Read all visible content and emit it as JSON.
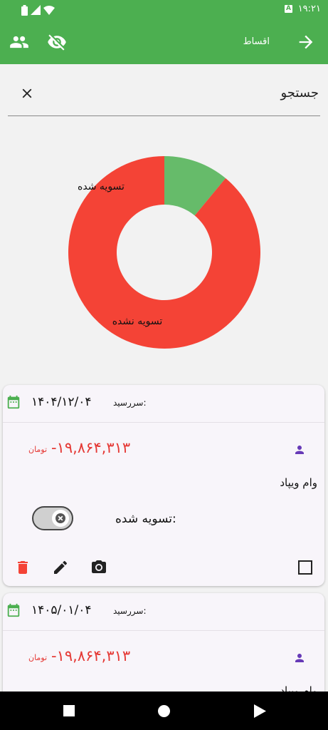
{
  "status_bar": {
    "time": "۱۹:۲۱",
    "badge": "A"
  },
  "app_bar": {
    "title": "اقساط"
  },
  "search": {
    "placeholder": "جستجو"
  },
  "chart_data": {
    "type": "pie",
    "slices": [
      {
        "label": "تسویه شده",
        "value": 11,
        "color": "#66bb6a"
      },
      {
        "label": "تسویه نشده",
        "value": 89,
        "color": "#f44336"
      }
    ]
  },
  "installments": [
    {
      "due_label": "سررسید:",
      "due_date": "۱۴۰۴/۱۲/۰۴",
      "amount": "-۱۹,۸۶۴,۳۱۳",
      "currency": "تومان",
      "description": "وام ویپاد",
      "settled_label": "تسویه شده:"
    },
    {
      "due_label": "سررسید:",
      "due_date": "۱۴۰۵/۰۱/۰۴",
      "amount": "-۱۹,۸۶۴,۳۱۳",
      "currency": "تومان",
      "description": "وام ویپاد"
    }
  ],
  "colors": {
    "primary": "#4caf50",
    "negative": "#e53935",
    "accent": "#673ab7"
  }
}
